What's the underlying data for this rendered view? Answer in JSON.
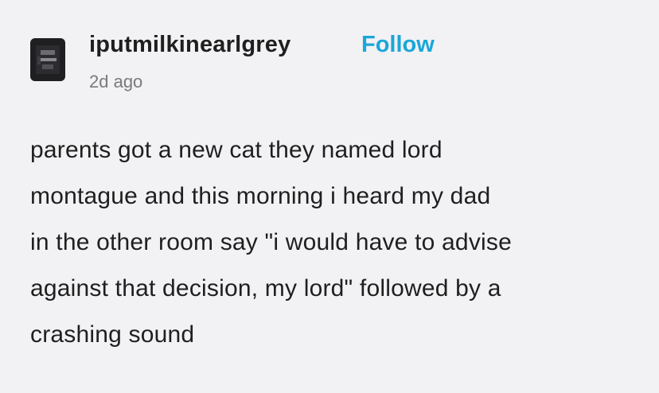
{
  "post": {
    "username": "iputmilkinearlgrey",
    "follow_label": "Follow",
    "timestamp": "2d ago",
    "avatar_icon": "user-avatar-icon",
    "body_lines": [
      "parents got a new cat they named lord",
      "montague and this morning i heard my dad",
      "in the other room say \"i would have to advise",
      "against that decision, my lord\" followed by a",
      "crashing sound"
    ]
  },
  "colors": {
    "background": "#f2f1f3",
    "text": "#1f1f1f",
    "follow_accent": "#1aa7d9",
    "timestamp": "#7a7a7a"
  }
}
